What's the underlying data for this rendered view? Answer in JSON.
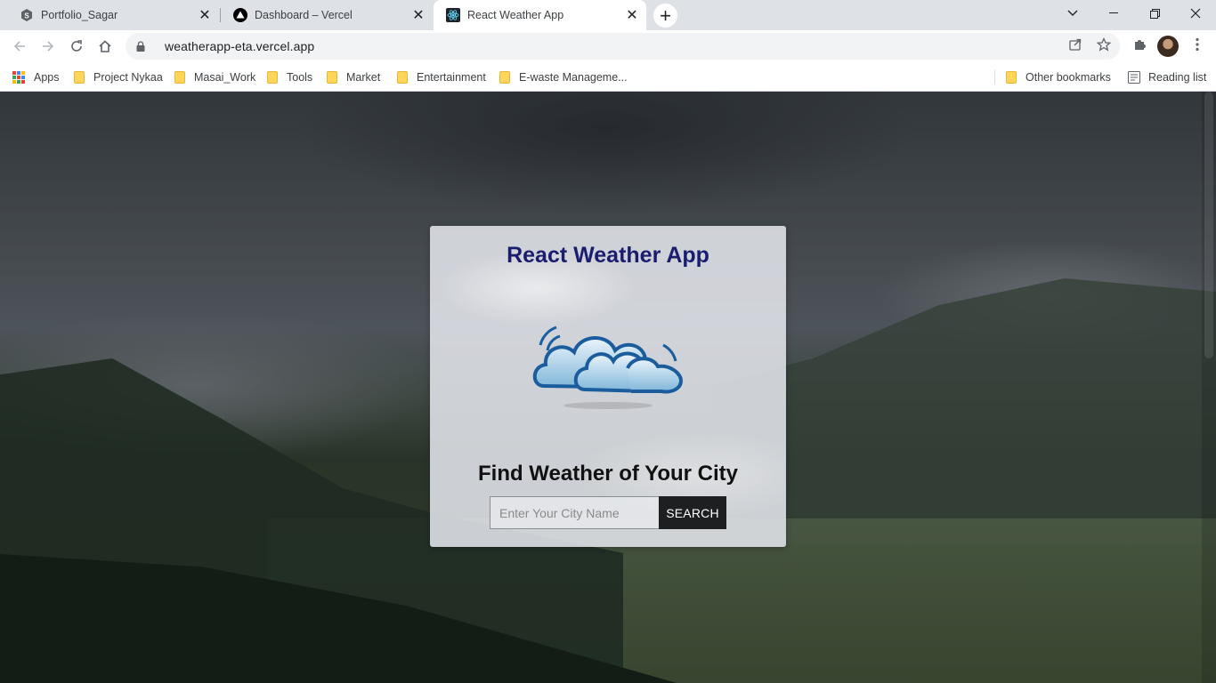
{
  "browser": {
    "tabs": [
      {
        "title": "Portfolio_Sagar",
        "favicon": "portfolio-favicon",
        "active": false
      },
      {
        "title": "Dashboard – Vercel",
        "favicon": "vercel-favicon",
        "active": false
      },
      {
        "title": "React Weather App",
        "favicon": "react-favicon",
        "active": true
      }
    ],
    "new_tab_symbol": "+",
    "url": "weatherapp-eta.vercel.app",
    "bookmarks": [
      {
        "label": "Apps",
        "icon": "apps-grid-icon"
      },
      {
        "label": "Project Nykaa",
        "icon": "folder-icon"
      },
      {
        "label": "Masai_Work",
        "icon": "folder-icon"
      },
      {
        "label": "Tools",
        "icon": "folder-icon"
      },
      {
        "label": "Market",
        "icon": "folder-icon"
      },
      {
        "label": "Entertainment",
        "icon": "folder-icon"
      },
      {
        "label": "E-waste Manageme...",
        "icon": "folder-icon"
      }
    ],
    "other_bookmarks": "Other bookmarks",
    "reading_list": "Reading list"
  },
  "app": {
    "title": "React Weather App",
    "logo": "cloud-logo-icon",
    "heading": "Find Weather of Your City",
    "search": {
      "placeholder": "Enter Your City Name",
      "value": "",
      "button_label": "SEARCH"
    }
  },
  "colors": {
    "title": "#1a1d6e",
    "button_bg": "#1e1f21",
    "card_bg": "#e2e5ea",
    "tab_strip": "#dee1e6"
  }
}
